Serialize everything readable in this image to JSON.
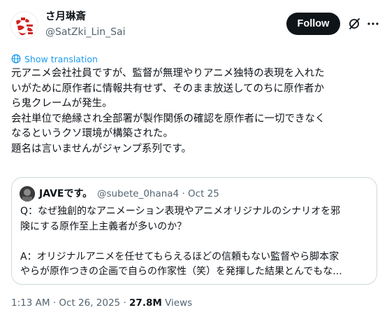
{
  "author": {
    "display_name": "さ月琳斎",
    "handle": "@SatZki_Lin_Sai"
  },
  "actions": {
    "follow_label": "Follow"
  },
  "translate_label": "Show translation",
  "post_lines": [
    "元アニメ会社社員ですが、監督が無理やりアニメ独特の表現を入れた",
    "いがために原作者に情報共有せず、そのまま放送してのちに原作者か",
    "ら鬼クレームが発生。",
    "会社単位で絶縁され全部署が製作関係の確認を原作者に一切できなく",
    "なるというクソ環境が構築された。",
    "題名は言いませんがジャンプ系列です。"
  ],
  "quote": {
    "display_name": "JAVEです。",
    "handle": "@subete_0hana4",
    "separator": "·",
    "date": "Oct 25",
    "lines": [
      "Q：なぜ独創的なアニメーション表現やアニメオリジナルのシナリオを邪",
      "険にする原作至上主義者が多いのか？",
      "",
      "A：オリジナルアニメを任せてもらえるほどの信頼もない監督やら脚本家",
      "やらが原作つきの企画で自らの作家性（笑）を発揮した結果とんでもな..."
    ]
  },
  "meta": {
    "time": "1:13 AM",
    "separator": "·",
    "date": "Oct 26, 2025",
    "views_count": "27.8M",
    "views_label": "Views"
  },
  "colors": {
    "accent": "#1d9bf0",
    "text": "#0f1419",
    "secondary": "#536471",
    "border": "#cfd9de"
  }
}
